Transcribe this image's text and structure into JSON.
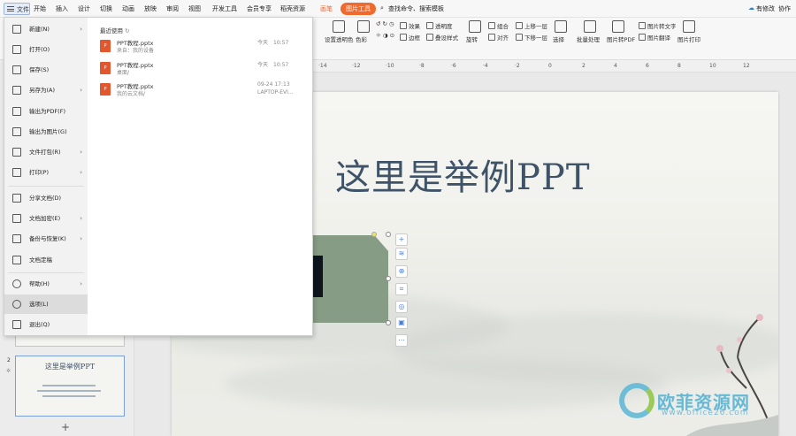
{
  "tabs": {
    "file": "文件",
    "start": "开始",
    "insert": "插入",
    "design": "设计",
    "transition": "切换",
    "animation": "动画",
    "slideshow": "放映",
    "review": "审阅",
    "view": "视图",
    "developer": "开发工具",
    "member": "会员专享",
    "resources": "稻壳资源",
    "drawing": "画笔",
    "picture_tools": "图片工具",
    "search": "查找命令、搜索模板",
    "modified": "有修改",
    "collab": "协作"
  },
  "ribbon": {
    "transparent_color": "设置透明色",
    "color": "色彩",
    "effect": "效果",
    "transparency": "透明度",
    "border": "边框",
    "overlay_style": "叠设样式",
    "rotate": "旋转",
    "combine": "组合",
    "align": "对齐",
    "bring_forward": "上移一层",
    "send_backward": "下移一层",
    "select": "选择",
    "batch": "批量处理",
    "pic_to_pdf": "图片转PDF",
    "pic_to_text": "图片转文字",
    "pic_translate": "图片翻译",
    "pic_print": "图片打印"
  },
  "file_menu": {
    "items": [
      {
        "label": "新建(N)",
        "arrow": "›"
      },
      {
        "label": "打开(O)",
        "arrow": ""
      },
      {
        "label": "保存(S)",
        "arrow": ""
      },
      {
        "label": "另存为(A)",
        "arrow": "›"
      },
      {
        "label": "输出为PDF(F)",
        "arrow": ""
      },
      {
        "label": "输出为图片(G)",
        "arrow": ""
      },
      {
        "label": "文件打包(R)",
        "arrow": "›"
      },
      {
        "label": "打印(P)",
        "arrow": "›"
      },
      {
        "label": "分享文档(D)",
        "arrow": ""
      },
      {
        "label": "文档加密(E)",
        "arrow": "›"
      },
      {
        "label": "备份与恢复(K)",
        "arrow": "›"
      },
      {
        "label": "文档定稿",
        "arrow": ""
      },
      {
        "label": "帮助(H)",
        "arrow": "›"
      },
      {
        "label": "选项(L)",
        "arrow": ""
      },
      {
        "label": "退出(Q)",
        "arrow": ""
      }
    ],
    "recent_header": "最近使用",
    "recent_files": [
      {
        "name": "PPT教程.pptx",
        "path": "来自：我的设备",
        "time": "今天　10:57",
        "location": ""
      },
      {
        "name": "PPT教程.pptx",
        "path": "桌面/",
        "time": "今天　10:57",
        "location": ""
      },
      {
        "name": "PPT教程.pptx",
        "path": "我的云文档/",
        "time": "09-24 17:13",
        "location": "LAPTOP-EVI..."
      }
    ]
  },
  "ruler": [
    "·14",
    "·12",
    "·10",
    "·8",
    "·6",
    "·4",
    "·2",
    "0",
    "2",
    "4",
    "6",
    "8",
    "10",
    "12"
  ],
  "slide": {
    "title": "这里是举例PPT"
  },
  "thumbnails": {
    "slide2_number": "2",
    "slide2_title": "这里是举例PPT",
    "add": "+"
  },
  "side_tools": [
    "+",
    "≋",
    "⊕",
    "⌗",
    "◎",
    "▣",
    "⋯"
  ],
  "watermark": {
    "brand": "欧菲资源网",
    "url": "www.office26.com"
  }
}
